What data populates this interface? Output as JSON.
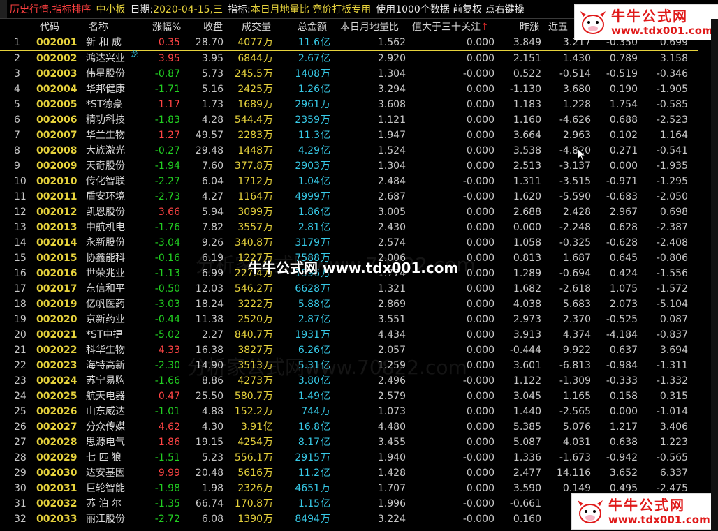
{
  "title_bar": {
    "view": "历史行情.指标排序",
    "board": "中小板",
    "date_label": "日期:",
    "date_value": "2020-04-15,三",
    "indicator_label": "指标:",
    "indicator_value": "本日月地量比 竞价打板专用",
    "usage": "使用1000个数据 前复权 点右键操"
  },
  "columns": {
    "code": "代码",
    "name": "名称",
    "change": "涨幅%",
    "close": "收盘",
    "volume": "成交量",
    "amount": "总金额",
    "ratio": "本日月地量比",
    "above30": "值大于三十关注",
    "arrow": "↑",
    "prev": "昨涨",
    "near5": "近五"
  },
  "rows": [
    {
      "n": "1",
      "code": "002001",
      "name": "新 和 成",
      "chg": "0.35",
      "close": "28.70",
      "vol": "4077",
      "vu": "万",
      "amt": "11.6",
      "au": "亿",
      "ratio": "1.562",
      "above": "0.000",
      "prev": "3.849",
      "c1": "3.217",
      "c2": "-0.350",
      "c3": "0.699"
    },
    {
      "n": "2",
      "code": "002002",
      "name": "鸿达兴业",
      "tag": "龙",
      "chg": "3.95",
      "close": "3.95",
      "vol": "6844",
      "vu": "万",
      "amt": "2.67",
      "au": "亿",
      "ratio": "2.920",
      "above": "0.000",
      "prev": "2.151",
      "c1": "1.430",
      "c2": "0.789",
      "c3": "3.158"
    },
    {
      "n": "3",
      "code": "002003",
      "name": "伟星股份",
      "chg": "-0.87",
      "close": "5.73",
      "vol": "245.5",
      "vu": "万",
      "amt": "1408",
      "au": "万",
      "ratio": "1.304",
      "above": "-0.000",
      "prev": "0.522",
      "c1": "-0.514",
      "c2": "-0.519",
      "c3": "-0.346"
    },
    {
      "n": "4",
      "code": "002004",
      "name": "华邦健康",
      "chg": "-1.71",
      "close": "5.16",
      "vol": "2425",
      "vu": "万",
      "amt": "1.26",
      "au": "亿",
      "ratio": "3.294",
      "above": "0.000",
      "prev": "-1.130",
      "c1": "3.680",
      "c2": "0.190",
      "c3": "-1.905"
    },
    {
      "n": "5",
      "code": "002005",
      "name": "*ST德豪",
      "chg": "1.17",
      "close": "1.73",
      "vol": "1689",
      "vu": "万",
      "amt": "2961",
      "au": "万",
      "ratio": "3.608",
      "above": "0.000",
      "prev": "1.183",
      "c1": "1.228",
      "c2": "1.754",
      "c3": "-0.585"
    },
    {
      "n": "6",
      "code": "002006",
      "name": "精功科技",
      "chg": "-1.83",
      "close": "4.28",
      "vol": "544.4",
      "vu": "万",
      "amt": "2359",
      "au": "万",
      "ratio": "1.121",
      "above": "0.000",
      "prev": "1.160",
      "c1": "-4.626",
      "c2": "0.688",
      "c3": "-2.523"
    },
    {
      "n": "7",
      "code": "002007",
      "name": "华兰生物",
      "chg": "1.27",
      "close": "49.57",
      "vol": "2283",
      "vu": "万",
      "amt": "11.3",
      "au": "亿",
      "ratio": "1.947",
      "above": "0.000",
      "prev": "3.664",
      "c1": "2.963",
      "c2": "0.102",
      "c3": "1.164"
    },
    {
      "n": "8",
      "code": "002008",
      "name": "大族激光",
      "chg": "-0.27",
      "close": "29.48",
      "vol": "1448",
      "vu": "万",
      "amt": "4.29",
      "au": "亿",
      "ratio": "1.524",
      "above": "0.000",
      "prev": "3.538",
      "c1": "-4.820",
      "c2": "0.271",
      "c3": "-0.541"
    },
    {
      "n": "9",
      "code": "002009",
      "name": "天奇股份",
      "chg": "-1.94",
      "close": "7.60",
      "vol": "377.8",
      "vu": "万",
      "amt": "2903",
      "au": "万",
      "ratio": "1.304",
      "above": "0.000",
      "prev": "2.513",
      "c1": "-3.137",
      "c2": "0.000",
      "c3": "-1.935"
    },
    {
      "n": "10",
      "code": "002010",
      "name": "传化智联",
      "chg": "-2.27",
      "close": "6.04",
      "vol": "1712",
      "vu": "万",
      "amt": "1.04",
      "au": "亿",
      "ratio": "2.484",
      "above": "-0.000",
      "prev": "1.311",
      "c1": "-3.515",
      "c2": "-0.971",
      "c3": "-1.295"
    },
    {
      "n": "11",
      "code": "002011",
      "name": "盾安环境",
      "chg": "-2.73",
      "close": "4.27",
      "vol": "1164",
      "vu": "万",
      "amt": "4999",
      "au": "万",
      "ratio": "2.687",
      "above": "-0.000",
      "prev": "1.620",
      "c1": "-5.590",
      "c2": "-0.683",
      "c3": "-2.050"
    },
    {
      "n": "12",
      "code": "002012",
      "name": "凯恩股份",
      "chg": "3.66",
      "close": "5.94",
      "vol": "3099",
      "vu": "万",
      "amt": "1.86",
      "au": "亿",
      "ratio": "3.005",
      "above": "0.000",
      "prev": "2.688",
      "c1": "2.428",
      "c2": "2.967",
      "c3": "0.698"
    },
    {
      "n": "13",
      "code": "002013",
      "name": "中航机电",
      "chg": "-1.76",
      "close": "7.82",
      "vol": "3557",
      "vu": "万",
      "amt": "2.81",
      "au": "亿",
      "ratio": "2.430",
      "above": "0.000",
      "prev": "0.000",
      "c1": "-2.248",
      "c2": "0.628",
      "c3": "-2.387"
    },
    {
      "n": "14",
      "code": "002014",
      "name": "永新股份",
      "chg": "-3.04",
      "close": "9.26",
      "vol": "340.8",
      "vu": "万",
      "amt": "3179",
      "au": "万",
      "ratio": "2.574",
      "above": "0.000",
      "prev": "1.058",
      "c1": "-0.325",
      "c2": "-0.628",
      "c3": "-2.408"
    },
    {
      "n": "15",
      "code": "002015",
      "name": "协鑫能科",
      "chg": "-0.16",
      "close": "6.19",
      "vol": "1227",
      "vu": "万",
      "amt": "7588",
      "au": "万",
      "ratio": "2.006",
      "above": "0.000",
      "prev": "0.813",
      "c1": "1.687",
      "c2": "0.645",
      "c3": "-0.806"
    },
    {
      "n": "16",
      "code": "002016",
      "name": "世荣兆业",
      "chg": "-1.13",
      "close": "6.99",
      "vol": "227.4",
      "vu": "万",
      "amt": "1596",
      "au": "万",
      "ratio": "1.774",
      "above": "0.000",
      "prev": "1.289",
      "c1": "-0.694",
      "c2": "0.424",
      "c3": "-1.556"
    },
    {
      "n": "17",
      "code": "002017",
      "name": "东信和平",
      "chg": "-0.50",
      "close": "12.03",
      "vol": "546.2",
      "vu": "万",
      "amt": "6628",
      "au": "万",
      "ratio": "1.321",
      "above": "0.000",
      "prev": "1.682",
      "c1": "-2.618",
      "c2": "1.075",
      "c3": "-1.572"
    },
    {
      "n": "18",
      "code": "002019",
      "name": "亿帆医药",
      "chg": "-3.03",
      "close": "18.24",
      "vol": "3222",
      "vu": "万",
      "amt": "5.88",
      "au": "亿",
      "ratio": "2.869",
      "above": "0.000",
      "prev": "4.038",
      "c1": "5.683",
      "c2": "2.073",
      "c3": "-5.104"
    },
    {
      "n": "19",
      "code": "002020",
      "name": "京新药业",
      "chg": "-0.44",
      "close": "11.38",
      "vol": "2520",
      "vu": "万",
      "amt": "2.87",
      "au": "亿",
      "ratio": "3.551",
      "above": "0.000",
      "prev": "2.973",
      "c1": "2.370",
      "c2": "-0.525",
      "c3": "0.087"
    },
    {
      "n": "20",
      "code": "002021",
      "name": "*ST中捷",
      "chg": "-5.02",
      "close": "2.27",
      "vol": "840.7",
      "vu": "万",
      "amt": "1931",
      "au": "万",
      "ratio": "4.434",
      "above": "0.000",
      "prev": "3.913",
      "c1": "4.374",
      "c2": "-4.184",
      "c3": "-0.837"
    },
    {
      "n": "21",
      "code": "002022",
      "name": "科华生物",
      "chg": "4.33",
      "close": "16.38",
      "vol": "3827",
      "vu": "万",
      "amt": "6.26",
      "au": "亿",
      "ratio": "2.057",
      "above": "0.000",
      "prev": "-0.444",
      "c1": "9.922",
      "c2": "0.637",
      "c3": "3.694"
    },
    {
      "n": "22",
      "code": "002023",
      "name": "海特高新",
      "chg": "-2.30",
      "close": "14.90",
      "vol": "3513",
      "vu": "万",
      "amt": "5.31",
      "au": "亿",
      "ratio": "1.259",
      "above": "0.000",
      "prev": "3.601",
      "c1": "-6.813",
      "c2": "-0.984",
      "c3": "-1.311"
    },
    {
      "n": "23",
      "code": "002024",
      "name": "苏宁易购",
      "chg": "-1.66",
      "close": "8.86",
      "vol": "4273",
      "vu": "万",
      "amt": "3.80",
      "au": "亿",
      "ratio": "2.496",
      "above": "-0.000",
      "prev": "1.122",
      "c1": "-1.309",
      "c2": "-0.333",
      "c3": "-1.332"
    },
    {
      "n": "24",
      "code": "002025",
      "name": "航天电器",
      "chg": "0.47",
      "close": "25.50",
      "vol": "580.7",
      "vu": "万",
      "amt": "1.49",
      "au": "亿",
      "ratio": "2.579",
      "above": "0.000",
      "prev": "3.045",
      "c1": "1.165",
      "c2": "0.158",
      "c3": "0.315"
    },
    {
      "n": "25",
      "code": "002026",
      "name": "山东威达",
      "chg": "-1.01",
      "close": "4.88",
      "vol": "152.2",
      "vu": "万",
      "amt": "744",
      "au": "万",
      "ratio": "1.073",
      "above": "0.000",
      "prev": "1.440",
      "c1": "-2.565",
      "c2": "0.000",
      "c3": "-1.014"
    },
    {
      "n": "26",
      "code": "002027",
      "name": "分众传媒",
      "chg": "4.62",
      "close": "4.30",
      "vol": "3.91",
      "vu": "亿",
      "amt": "16.8",
      "au": "亿",
      "ratio": "4.480",
      "above": "0.000",
      "prev": "5.385",
      "c1": "5.076",
      "c2": "1.217",
      "c3": "3.406"
    },
    {
      "n": "27",
      "code": "002028",
      "name": "思源电气",
      "chg": "1.86",
      "close": "19.15",
      "vol": "4254",
      "vu": "万",
      "amt": "8.17",
      "au": "亿",
      "ratio": "3.455",
      "above": "0.000",
      "prev": "5.087",
      "c1": "4.031",
      "c2": "0.638",
      "c3": "1.223"
    },
    {
      "n": "28",
      "code": "002029",
      "name": "七 匹 狼",
      "chg": "-1.51",
      "close": "5.23",
      "vol": "556.1",
      "vu": "万",
      "amt": "2915",
      "au": "万",
      "ratio": "1.940",
      "above": "-0.000",
      "prev": "1.336",
      "c1": "-1.673",
      "c2": "-0.942",
      "c3": "-0.565"
    },
    {
      "n": "29",
      "code": "002030",
      "name": "达安基因",
      "chg": "9.99",
      "close": "20.48",
      "vol": "5616",
      "vu": "万",
      "amt": "11.2",
      "au": "亿",
      "ratio": "1.428",
      "above": "0.000",
      "prev": "2.477",
      "c1": "14.116",
      "c2": "3.652",
      "c3": "6.337"
    },
    {
      "n": "30",
      "code": "002031",
      "name": "巨轮智能",
      "chg": "-1.98",
      "close": "1.98",
      "vol": "2326",
      "vu": "万",
      "amt": "4651",
      "au": "万",
      "ratio": "1.707",
      "above": "0.000",
      "prev": "3.590",
      "c1": "0.149",
      "c2": "0.495",
      "c3": "-2.475"
    },
    {
      "n": "31",
      "code": "002032",
      "name": "苏 泊 尔",
      "chg": "-1.35",
      "close": "66.74",
      "vol": "170.8",
      "vu": "万",
      "amt": "1.15",
      "au": "亿",
      "ratio": "1.996",
      "above": "-0.000",
      "prev": "-0.661",
      "c1": "-5.",
      "c2": "",
      "c3": ""
    },
    {
      "n": "32",
      "code": "002033",
      "name": "丽江股份",
      "chg": "-2.72",
      "close": "6.08",
      "vol": "1390",
      "vu": "万",
      "amt": "8494",
      "au": "万",
      "ratio": "3.224",
      "above": "-0.000",
      "prev": "0.160",
      "c1": "-3.",
      "c2": "",
      "c3": ""
    }
  ],
  "watermarks": {
    "center": "牛牛公式网 www.tdx001.com",
    "faint1": "分析家公式网www.70822.com",
    "faint2": "分析家公式网www.70822.com"
  },
  "badge": {
    "title": "牛牛公式网",
    "url": "www.tdx001.com"
  },
  "colors": {
    "up": "#ff4444",
    "down": "#22d022",
    "code": "#e6d23c",
    "amount_unit": "#37c9e6"
  }
}
